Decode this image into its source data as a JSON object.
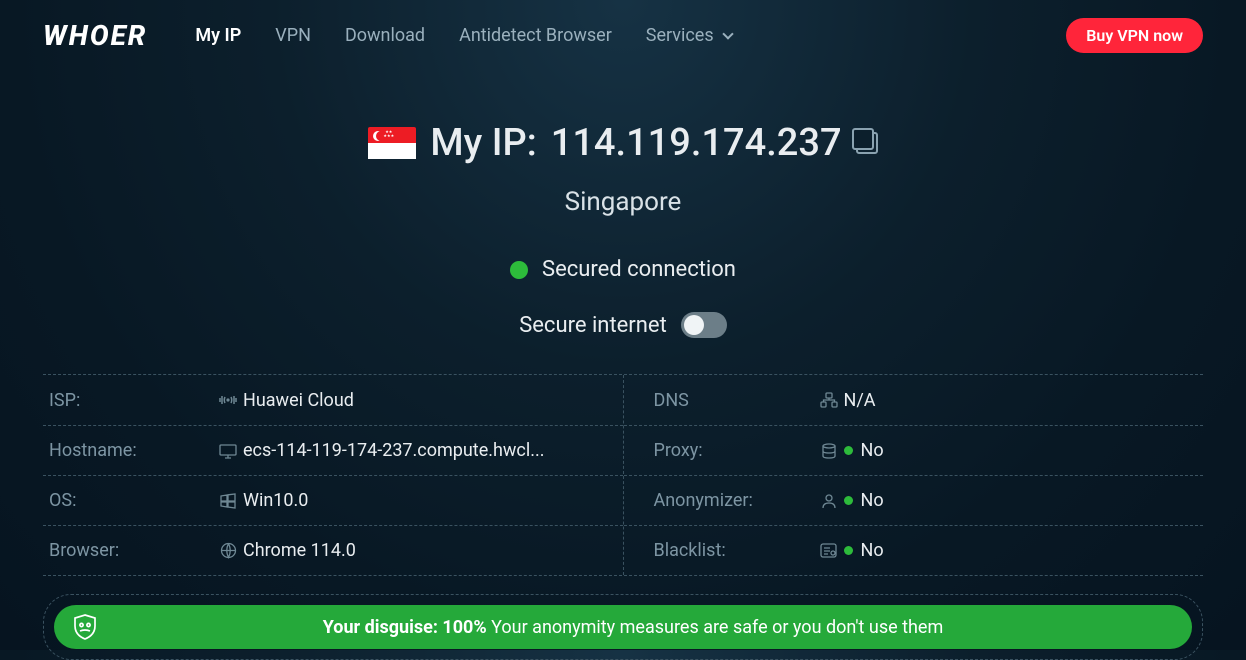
{
  "logo": "WHOER",
  "nav": {
    "myip": "My IP",
    "vpn": "VPN",
    "download": "Download",
    "antidetect": "Antidetect Browser",
    "services": "Services"
  },
  "buy_btn": "Buy VPN now",
  "hero": {
    "title_prefix": "My IP:",
    "ip": "114.119.174.237",
    "country": "Singapore",
    "secured": "Secured connection",
    "secure_internet": "Secure internet"
  },
  "left": {
    "isp_label": "ISP:",
    "isp_value": "Huawei Cloud",
    "host_label": "Hostname:",
    "host_value": "ecs-114-119-174-237.compute.hwcl...",
    "os_label": "OS:",
    "os_value": "Win10.0",
    "browser_label": "Browser:",
    "browser_value": "Chrome 114.0"
  },
  "right": {
    "dns_label": "DNS",
    "dns_value": "N/A",
    "proxy_label": "Proxy:",
    "proxy_value": "No",
    "anon_label": "Anonymizer:",
    "anon_value": "No",
    "black_label": "Blacklist:",
    "black_value": "No"
  },
  "disguise": {
    "prefix": "Your disguise: ",
    "percent": "100%",
    "suffix": " Your anonymity measures are safe or you don't use them"
  }
}
